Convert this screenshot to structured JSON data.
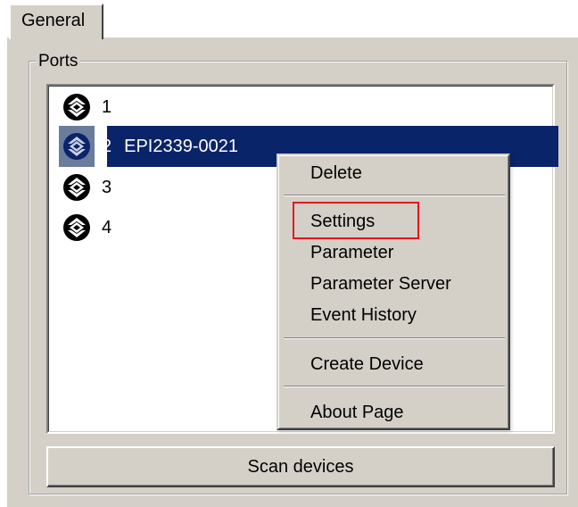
{
  "tabs": [
    {
      "label": "General"
    }
  ],
  "group": {
    "title": "Ports"
  },
  "ports": [
    {
      "number": "1",
      "device": ""
    },
    {
      "number": "2",
      "device": "EPI2339-0021"
    },
    {
      "number": "3",
      "device": ""
    },
    {
      "number": "4",
      "device": ""
    }
  ],
  "context_menu": {
    "items": [
      {
        "label": "Delete"
      },
      {
        "label": "Settings"
      },
      {
        "label": "Parameter"
      },
      {
        "label": "Parameter Server"
      },
      {
        "label": "Event History"
      },
      {
        "label": "Create Device"
      },
      {
        "label": "About Page"
      }
    ],
    "highlighted_item": "Settings",
    "highlight_color": "#e8141c"
  },
  "scan_button": {
    "label": "Scan devices"
  },
  "colors": {
    "selection": "#0a246a",
    "face": "#d4d0c8"
  }
}
